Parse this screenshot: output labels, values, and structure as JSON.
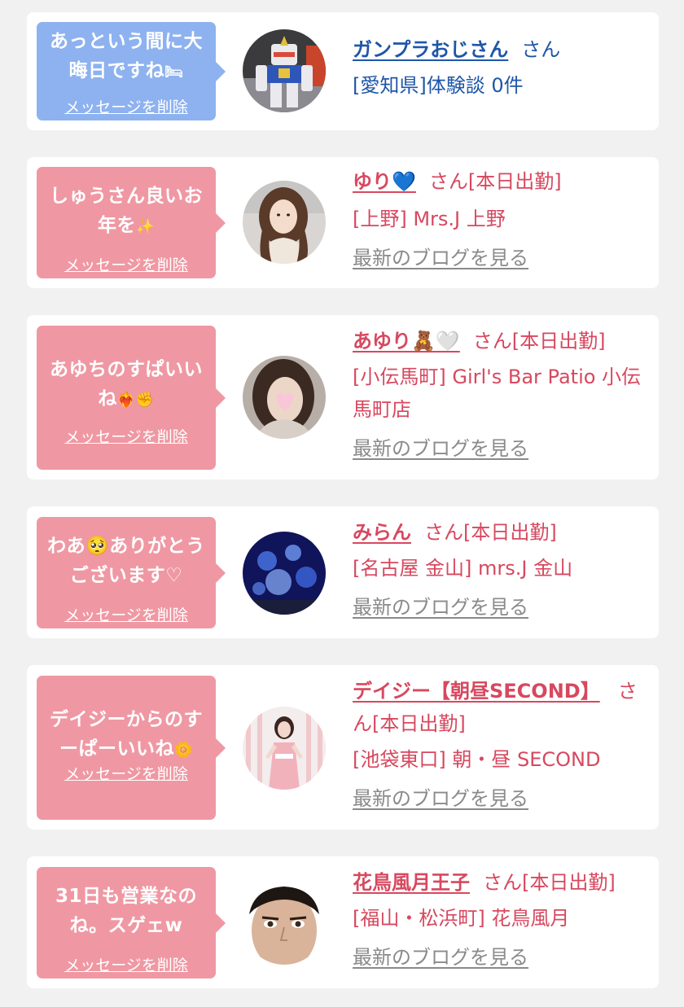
{
  "colors": {
    "bubble_blue": "#8db2ef",
    "bubble_pink": "#ef98a3",
    "link_blue": "#1f56a8",
    "link_pink": "#d7485f",
    "muted": "#8a8a8a"
  },
  "cards": [
    {
      "message": "あっという間に大晦日ですね",
      "message_emoji": "🛏",
      "delete_label": "メッセージを削除",
      "name": "ガンプラおじさん",
      "suffix": "さん",
      "location": "[愛知県]体験談 0件",
      "avatar": "gundam-figure"
    },
    {
      "message": "しゅうさん良いお年を",
      "message_emoji": "✨",
      "delete_label": "メッセージを削除",
      "name": "ゆり💙",
      "suffix": "さん[本日出勤]",
      "location": "[上野] Mrs.J 上野",
      "blog_label": "最新のブログを見る",
      "avatar": "woman-photo"
    },
    {
      "message": "あゆちのすぱいいね",
      "message_emoji": "❤‍🔥✊",
      "delete_label": "メッセージを削除",
      "name": "あゆり🧸🤍",
      "suffix": "さん[本日出勤]",
      "location": "[小伝馬町] Girl's Bar Patio 小伝馬町店",
      "blog_label": "最新のブログを見る",
      "avatar": "woman-photo-heart"
    },
    {
      "message": "わあ🥺ありがとうございます♡",
      "message_emoji": "",
      "delete_label": "メッセージを削除",
      "name": "みらん",
      "suffix": "さん[本日出勤]",
      "location": "[名古屋 金山] mrs.J 金山",
      "blog_label": "最新のブログを見る",
      "avatar": "jellyfish-photo"
    },
    {
      "message": "デイジーからのすーぱーいいね",
      "message_emoji": "🌼",
      "delete_label": "メッセージを削除",
      "name": "デイジー【朝昼SECOND】",
      "suffix": "さん[本日出勤]",
      "location": "[池袋東口] 朝・昼 SECOND",
      "blog_label": "最新のブログを見る",
      "avatar": "woman-dress-photo"
    },
    {
      "message": "31日も営業なのね。スゲェw",
      "message_emoji": "",
      "delete_label": "メッセージを削除",
      "name": "花鳥風月王子",
      "suffix": "さん[本日出勤]",
      "location": "[福山・松浜町] 花鳥風月",
      "blog_label": "最新のブログを見る",
      "avatar": "man-face-photo"
    }
  ]
}
